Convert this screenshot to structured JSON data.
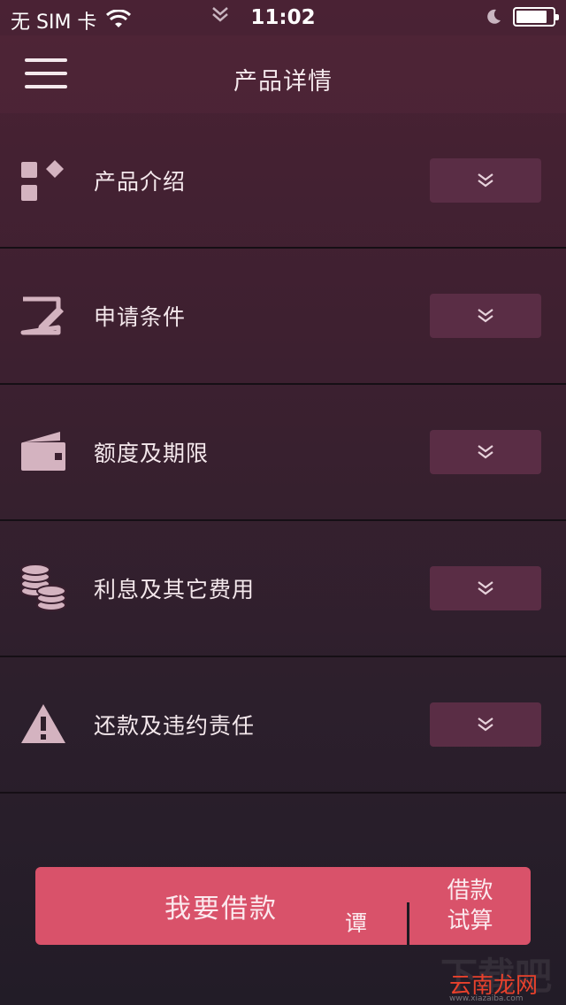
{
  "status_bar": {
    "carrier": "无 SIM 卡",
    "time": "11:02",
    "battery_level": 0.85
  },
  "nav": {
    "title": "产品详情",
    "menu_icon": "hamburger-menu-icon"
  },
  "sections": [
    {
      "label": "产品介绍",
      "icon": "product-grid-icon"
    },
    {
      "label": "申请条件",
      "icon": "edit-form-icon"
    },
    {
      "label": "额度及期限",
      "icon": "wallet-icon"
    },
    {
      "label": "利息及其它费用",
      "icon": "coins-icon"
    },
    {
      "label": "还款及违约责任",
      "icon": "warning-icon"
    }
  ],
  "footer": {
    "apply_label": "我要借款",
    "calc_line1": "借款",
    "calc_line2": "试算",
    "stray_char": "谭"
  },
  "watermark": {
    "brand": "云南龙网",
    "logo_text": "下载吧",
    "url": "www.xiazaiba.com"
  },
  "colors": {
    "accent": "#d9526a",
    "toggle_bg": "#5a2d45",
    "icon": "#d4b3c0"
  }
}
